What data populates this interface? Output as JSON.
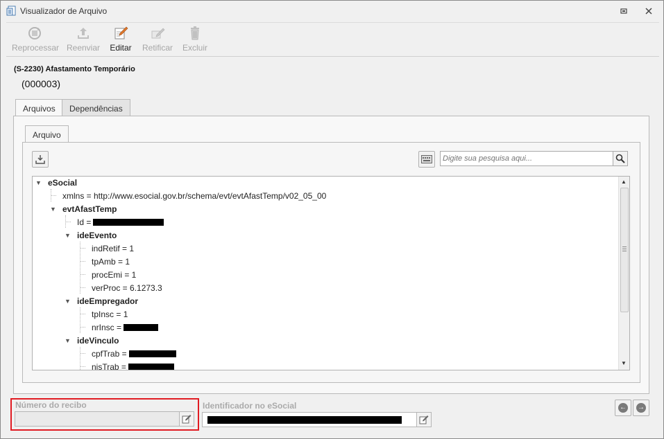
{
  "window": {
    "title": "Visualizador de Arquivo"
  },
  "toolbar": {
    "reprocess": "Reprocessar",
    "resend": "Reenviar",
    "edit": "Editar",
    "rectify": "Retificar",
    "delete": "Excluir"
  },
  "event": {
    "title": "(S-2230) Afastamento Temporário",
    "code": "(000003)"
  },
  "tabs": {
    "files": "Arquivos",
    "dependencies": "Dependências",
    "file": "Arquivo"
  },
  "search": {
    "placeholder": "Digite sua pesquisa aqui..."
  },
  "tree": {
    "root": "eSocial",
    "xmlns": "xmlns = http://www.esocial.gov.br/schema/evt/evtAfastTemp/v02_05_00",
    "evtAfastTemp": "evtAfastTemp",
    "id": "Id =",
    "ideEvento": "ideEvento",
    "indRetif": "indRetif = 1",
    "tpAmb": "tpAmb = 1",
    "procEmi": "procEmi = 1",
    "verProc": "verProc = 6.1273.3",
    "ideEmpregador": "ideEmpregador",
    "tpInsc": "tpInsc = 1",
    "nrInsc": "nrInsc =",
    "ideVinculo": "ideVinculo",
    "cpfTrab": "cpfTrab =",
    "nisTrab": "nisTrab ="
  },
  "footer": {
    "receipt_label": "Número do recibo",
    "receipt_value": "",
    "esocial_id_label": "Identificador no eSocial"
  },
  "colors": {
    "highlight": "#e11b22",
    "disabled_text": "#a6a6a6"
  }
}
